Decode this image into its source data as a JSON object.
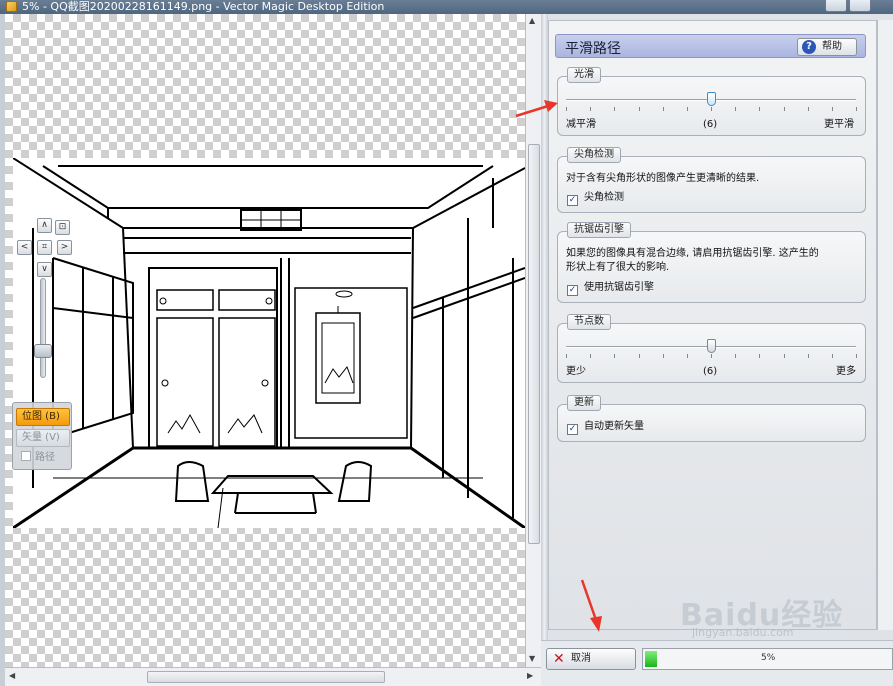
{
  "window": {
    "title": "5% - QQ截图20200228161149.png - Vector Magic Desktop Edition"
  },
  "nav": {
    "up": "∧",
    "down": "∨",
    "left": "<",
    "right": ">",
    "fit": "⌗",
    "center": "⊡"
  },
  "modes": [
    {
      "label": "位图 (B)",
      "active": true
    },
    {
      "label": "矢量 (V)",
      "active": false
    },
    {
      "label": "路径",
      "active": false
    }
  ],
  "panel": {
    "title": "平滑路径",
    "help_label": "帮助",
    "smooth": {
      "label": "光滑",
      "min_label": "减平滑",
      "max_label": "更平滑",
      "value_label": "(6)",
      "value": 6,
      "min": 0,
      "max": 12
    },
    "corner": {
      "label": "尖角检测",
      "description": "对于含有尖角形状的图像产生更清晰的结果.",
      "checkbox_label": "尖角检测",
      "checked": true
    },
    "antialias": {
      "label": "抗锯齿引擎",
      "description_line1": "如果您的图像具有混合边缘, 请启用抗锯齿引擎. 这产生的",
      "description_line2": "形状上有了很大的影响.",
      "checkbox_label": "使用抗锯齿引擎",
      "checked": true
    },
    "nodes": {
      "label": "节点数",
      "min_label": "更少",
      "max_label": "更多",
      "value_label": "(6)",
      "value": 6,
      "min": 0,
      "max": 12
    },
    "update": {
      "label": "更新",
      "checkbox_label": "自动更新矢量",
      "checked": true
    }
  },
  "bottom": {
    "cancel_label": "取消",
    "progress_text": "5%",
    "progress": 0.05
  },
  "watermark": {
    "text": "Baidu经验",
    "sub": "jingyan.baidu.com"
  },
  "colors": {
    "accent_mode": "#f59a0b",
    "header": "#aab5e0",
    "arrow": "#e8362b",
    "progress": "#1bb31b"
  }
}
